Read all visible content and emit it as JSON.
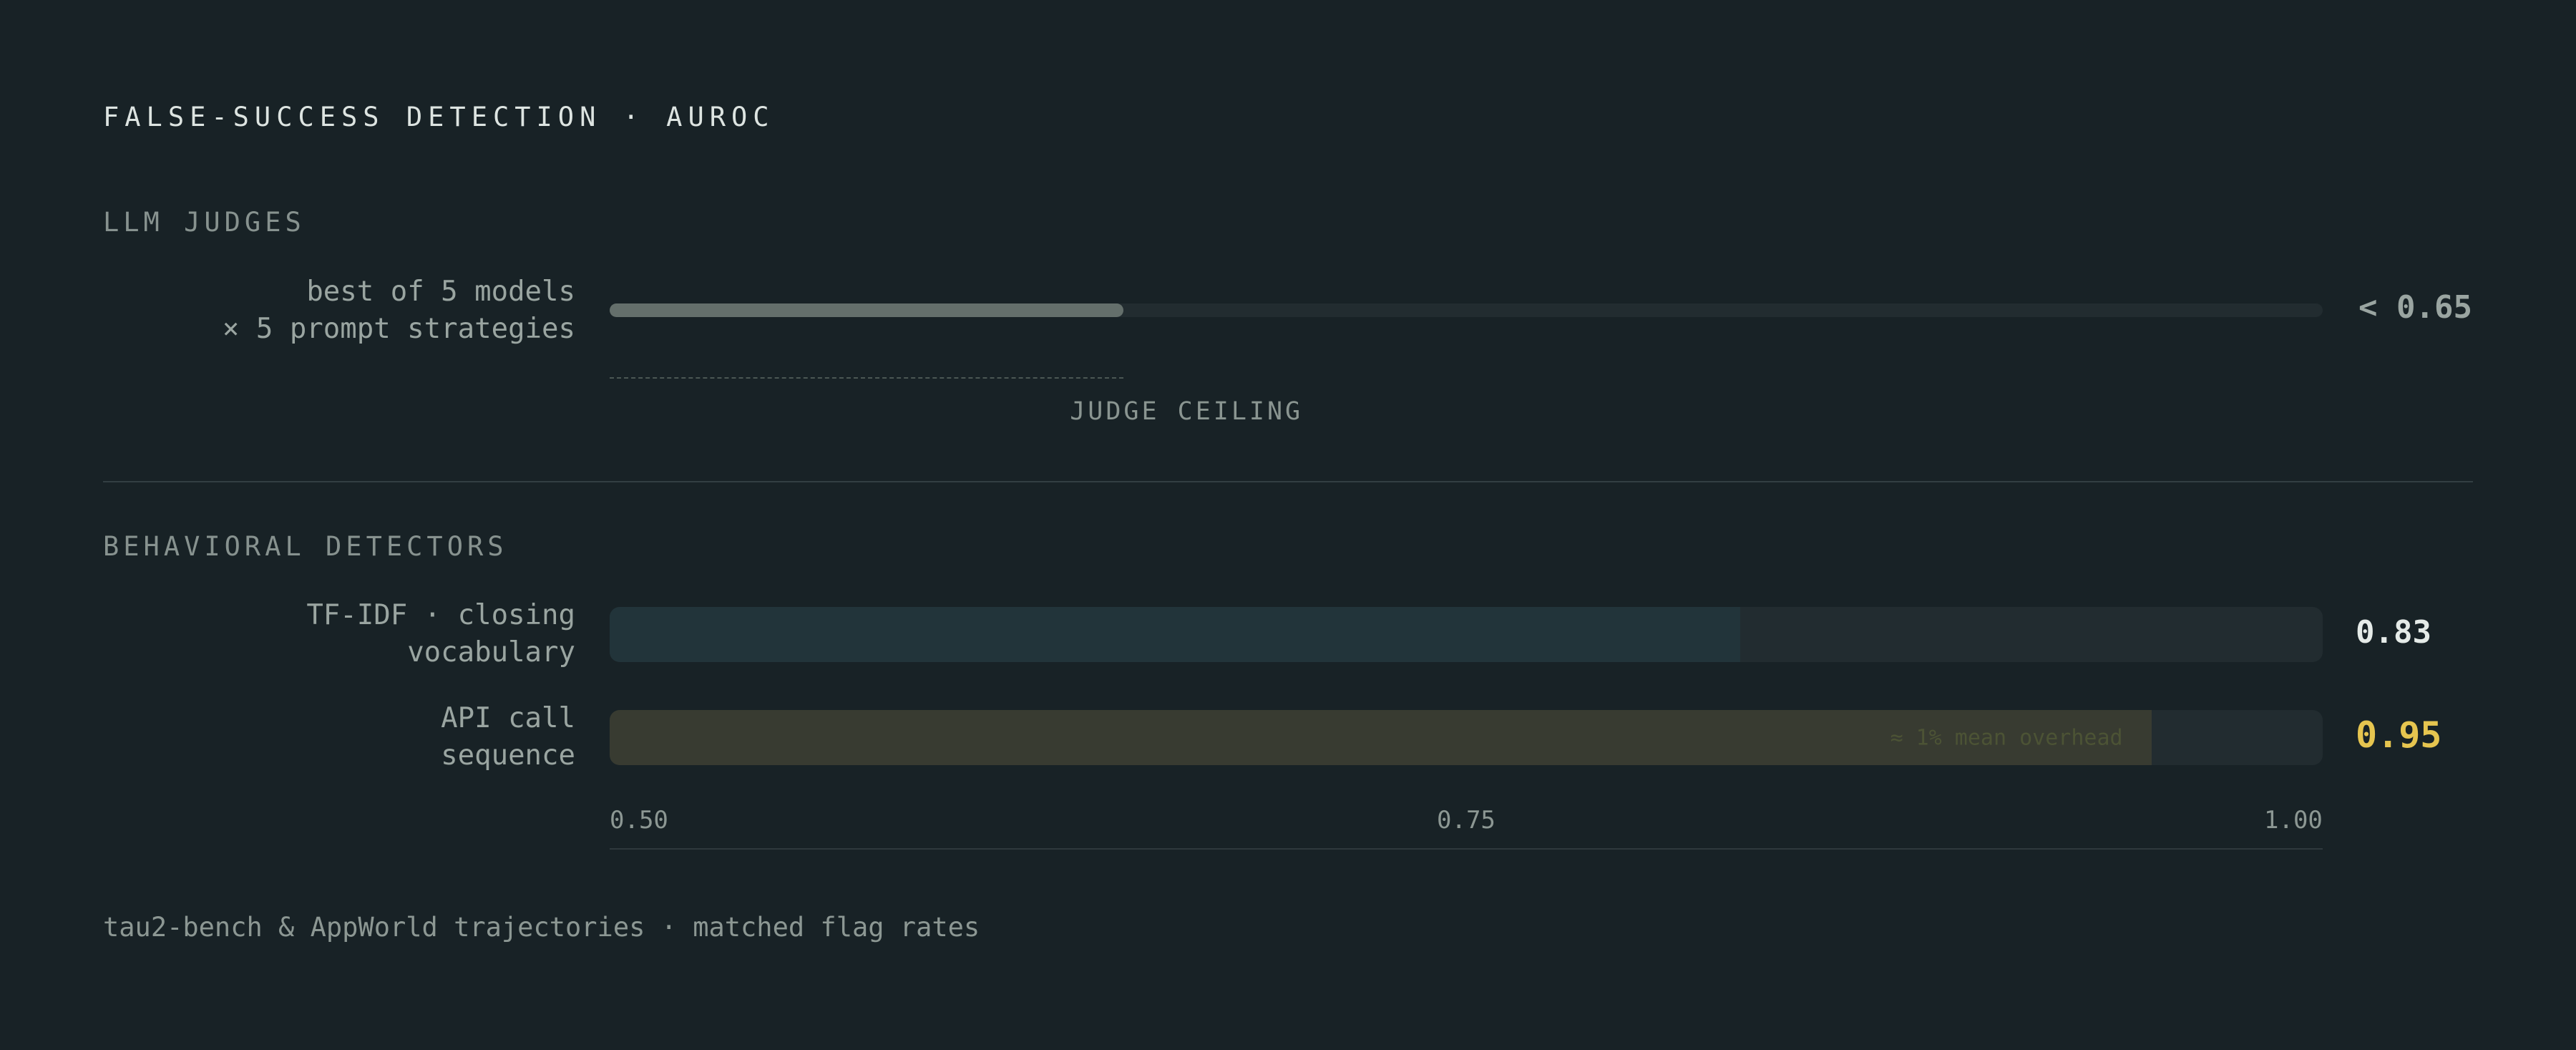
{
  "title": "FALSE-SUCCESS DETECTION · AUROC",
  "sections": {
    "judges": {
      "label": "LLM JUDGES"
    },
    "behavioral": {
      "label": "BEHAVIORAL DETECTORS"
    }
  },
  "judge_row": {
    "label_line1": "best of 5 models",
    "label_line2": "× 5 prompt strategies",
    "value_text": "< 0.65",
    "ceiling_label": "JUDGE CEILING"
  },
  "tfidf_row": {
    "label_line1": "TF-IDF · closing",
    "label_line2": "vocabulary",
    "value_text": "0.83"
  },
  "api_row": {
    "label_line1": "API call",
    "label_line2": "sequence",
    "value_text": "0.95",
    "bar_note": "≈ 1% mean overhead"
  },
  "footer": "tau2-bench & AppWorld trajectories · matched flag rates",
  "colors": {
    "background": "#182226",
    "judge_bar": "#646f6b",
    "tfidf_bar": "#22343a",
    "api_bar": "#383b31",
    "api_value": "#e6c54f",
    "tfidf_value": "#e5ebe8",
    "judge_value": "#9aa5a1"
  },
  "chart_data": {
    "type": "bar",
    "orientation": "horizontal",
    "categories": [
      "best of 5 models × 5 prompt strategies",
      "TF-IDF · closing vocabulary",
      "API call sequence"
    ],
    "values": [
      0.65,
      0.83,
      0.95
    ],
    "value_labels": [
      "< 0.65",
      "0.83",
      "0.95"
    ],
    "xlim": [
      0.5,
      1.0
    ],
    "ticks": [
      0.5,
      0.75,
      1.0
    ],
    "tick_labels": [
      "0.50",
      "0.75",
      "1.00"
    ],
    "reference_line": {
      "value": 0.65,
      "label": "JUDGE CEILING"
    }
  }
}
